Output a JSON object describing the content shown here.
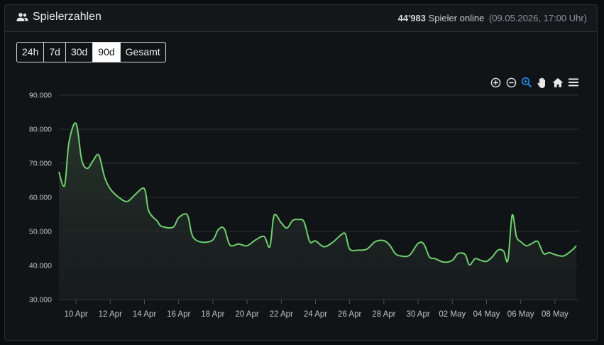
{
  "header": {
    "title": "Spielerzahlen",
    "count": "44'983",
    "count_label": "Spieler online",
    "timestamp": "(09.05.2026, 17:00 Uhr)",
    "icon": "users-icon"
  },
  "range_buttons": [
    {
      "label": "24h",
      "active": false
    },
    {
      "label": "7d",
      "active": false
    },
    {
      "label": "30d",
      "active": false
    },
    {
      "label": "90d",
      "active": true
    },
    {
      "label": "Gesamt",
      "active": false
    }
  ],
  "toolbar": {
    "icons": [
      "zoom-in-icon",
      "zoom-out-icon",
      "selection-zoom-icon",
      "pan-hand-icon",
      "reset-home-icon",
      "menu-icon"
    ],
    "active": "selection-zoom-icon"
  },
  "colors": {
    "line": "#6fcf6f",
    "grid": "#2a2f33",
    "tick": "#bfc4c8",
    "accent_active_tool": "#1e88e5"
  },
  "chart_data": {
    "type": "area",
    "title": "",
    "xlabel": "",
    "ylabel": "",
    "ylim": [
      30000,
      90000
    ],
    "y_ticks": [
      90000,
      80000,
      70000,
      60000,
      50000,
      40000,
      30000
    ],
    "y_tick_labels": [
      "90.000",
      "80.000",
      "70.000",
      "60.000",
      "50.000",
      "40.000",
      "30.000"
    ],
    "x_range": [
      "2026-04-09",
      "2026-05-09"
    ],
    "x_tick_labels": [
      "10 Apr",
      "12 Apr",
      "14 Apr",
      "16 Apr",
      "18 Apr",
      "20 Apr",
      "22 Apr",
      "24 Apr",
      "26 Apr",
      "28 Apr",
      "30 Apr",
      "02 May",
      "04 May",
      "06 May",
      "08 May"
    ],
    "x_tick_dates": [
      "2026-04-10",
      "2026-04-12",
      "2026-04-14",
      "2026-04-16",
      "2026-04-18",
      "2026-04-20",
      "2026-04-22",
      "2026-04-24",
      "2026-04-26",
      "2026-04-28",
      "2026-04-30",
      "2026-05-02",
      "2026-05-04",
      "2026-05-06",
      "2026-05-08"
    ],
    "grid": true,
    "legend": "none",
    "series": [
      {
        "points": [
          [
            "2026-04-09",
            67500
          ],
          [
            "2026-04-09 08:00",
            63500
          ],
          [
            "2026-04-09 14:00",
            76000
          ],
          [
            "2026-04-10",
            81700
          ],
          [
            "2026-04-10 08:00",
            71000
          ],
          [
            "2026-04-10 16:00",
            68500
          ],
          [
            "2026-04-11",
            70800
          ],
          [
            "2026-04-11 08:00",
            72400
          ],
          [
            "2026-04-11 16:00",
            66000
          ],
          [
            "2026-04-12",
            62500
          ],
          [
            "2026-04-12 12:00",
            60000
          ],
          [
            "2026-04-13",
            58800
          ],
          [
            "2026-04-13 12:00",
            61000
          ],
          [
            "2026-04-14",
            62500
          ],
          [
            "2026-04-14 06:00",
            56000
          ],
          [
            "2026-04-14 18:00",
            53000
          ],
          [
            "2026-04-15",
            51500
          ],
          [
            "2026-04-15 16:00",
            51200
          ],
          [
            "2026-04-16",
            54000
          ],
          [
            "2026-04-16 12:00",
            54900
          ],
          [
            "2026-04-16 18:00",
            49500
          ],
          [
            "2026-04-17",
            47500
          ],
          [
            "2026-04-17 12:00",
            46800
          ],
          [
            "2026-04-18",
            47500
          ],
          [
            "2026-04-18 08:00",
            50600
          ],
          [
            "2026-04-18 16:00",
            50800
          ],
          [
            "2026-04-19",
            46000
          ],
          [
            "2026-04-19 12:00",
            46300
          ],
          [
            "2026-04-20",
            45800
          ],
          [
            "2026-04-20 12:00",
            47500
          ],
          [
            "2026-04-21",
            48500
          ],
          [
            "2026-04-21 08:00",
            45500
          ],
          [
            "2026-04-21 14:00",
            54700
          ],
          [
            "2026-04-22",
            52500
          ],
          [
            "2026-04-22 08:00",
            51000
          ],
          [
            "2026-04-22 16:00",
            53200
          ],
          [
            "2026-04-23",
            53500
          ],
          [
            "2026-04-23 08:00",
            52800
          ],
          [
            "2026-04-23 16:00",
            47000
          ],
          [
            "2026-04-24",
            47200
          ],
          [
            "2026-04-24 12:00",
            45500
          ],
          [
            "2026-04-25",
            46800
          ],
          [
            "2026-04-25 12:00",
            49000
          ],
          [
            "2026-04-25 18:00",
            49200
          ],
          [
            "2026-04-26",
            44800
          ],
          [
            "2026-04-26 12:00",
            44500
          ],
          [
            "2026-04-27",
            44800
          ],
          [
            "2026-04-27 12:00",
            47000
          ],
          [
            "2026-04-28",
            47300
          ],
          [
            "2026-04-28 08:00",
            46000
          ],
          [
            "2026-04-28 16:00",
            43500
          ],
          [
            "2026-04-29",
            42800
          ],
          [
            "2026-04-29 12:00",
            43000
          ],
          [
            "2026-04-30",
            46500
          ],
          [
            "2026-04-30 08:00",
            46300
          ],
          [
            "2026-04-30 16:00",
            42500
          ],
          [
            "2026-05-01",
            42000
          ],
          [
            "2026-05-01 12:00",
            41000
          ],
          [
            "2026-05-02",
            41500
          ],
          [
            "2026-05-02 08:00",
            43500
          ],
          [
            "2026-05-02 18:00",
            43200
          ],
          [
            "2026-05-03",
            40200
          ],
          [
            "2026-05-03 08:00",
            42000
          ],
          [
            "2026-05-03 16:00",
            41500
          ],
          [
            "2026-05-04",
            41200
          ],
          [
            "2026-05-04 08:00",
            42500
          ],
          [
            "2026-05-04 16:00",
            44500
          ],
          [
            "2026-05-05",
            44200
          ],
          [
            "2026-05-05 06:00",
            41500
          ],
          [
            "2026-05-05 12:00",
            54800
          ],
          [
            "2026-05-05 18:00",
            48500
          ],
          [
            "2026-05-06",
            47000
          ],
          [
            "2026-05-06 08:00",
            45800
          ],
          [
            "2026-05-06 16:00",
            46500
          ],
          [
            "2026-05-07",
            47000
          ],
          [
            "2026-05-07 08:00",
            43500
          ],
          [
            "2026-05-07 16:00",
            43800
          ],
          [
            "2026-05-08",
            43200
          ],
          [
            "2026-05-08 12:00",
            42800
          ],
          [
            "2026-05-09",
            44500
          ],
          [
            "2026-05-09 06:00",
            45800
          ]
        ]
      }
    ]
  }
}
